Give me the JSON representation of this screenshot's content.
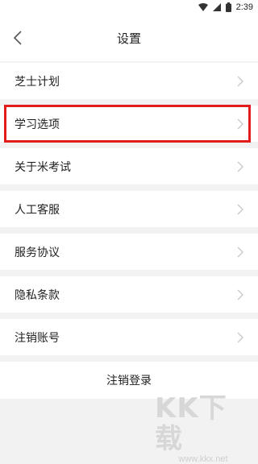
{
  "status_bar": {
    "time": "2:39",
    "icons": [
      "wifi-icon",
      "signal-icon",
      "battery-icon"
    ]
  },
  "header": {
    "title": "设置",
    "back_icon": "chevron-left-icon"
  },
  "menu": {
    "items": [
      {
        "label": "芝士计划"
      },
      {
        "label": "学习选项",
        "highlighted": true
      },
      {
        "label": "关于米考试"
      },
      {
        "label": "人工客服"
      },
      {
        "label": "服务协议"
      },
      {
        "label": "隐私条款"
      },
      {
        "label": "注销账号"
      }
    ]
  },
  "logout": {
    "label": "注销登录"
  },
  "watermark": {
    "logo_text": "KK下载",
    "url": "www.kkx.net"
  },
  "colors": {
    "highlight": "#e21b1b",
    "background": "#f2f2f2",
    "card": "#ffffff",
    "text": "#222222",
    "chevron": "#c8c8c8"
  }
}
